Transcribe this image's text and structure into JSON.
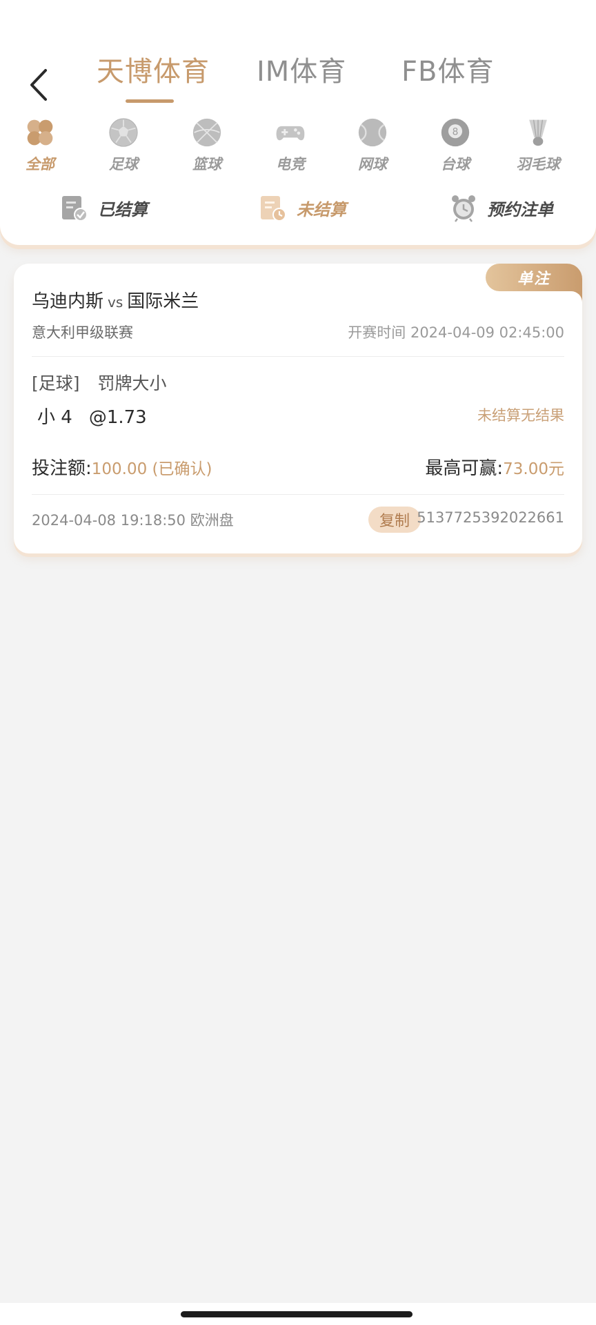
{
  "header": {
    "provider_tabs": [
      {
        "label": "天博体育"
      },
      {
        "label": "IM体育"
      },
      {
        "label": "FB体育"
      }
    ],
    "sports": [
      {
        "label": "全部",
        "icon": "clover-icon"
      },
      {
        "label": "足球",
        "icon": "soccer-ball-icon"
      },
      {
        "label": "篮球",
        "icon": "basketball-icon"
      },
      {
        "label": "电竞",
        "icon": "gamepad-icon"
      },
      {
        "label": "网球",
        "icon": "tennis-ball-icon"
      },
      {
        "label": "台球",
        "icon": "billiard-ball-icon"
      },
      {
        "label": "羽毛球",
        "icon": "shuttlecock-icon"
      }
    ],
    "status_tabs": [
      {
        "label": "已结算",
        "icon": "settled-doc-icon"
      },
      {
        "label": "未结算",
        "icon": "unsettled-doc-icon"
      },
      {
        "label": "预约注单",
        "icon": "alarm-clock-icon"
      }
    ]
  },
  "bet": {
    "badge": "单注",
    "home_team": "乌迪内斯",
    "vs": "vs",
    "away_team": "国际米兰",
    "league": "意大利甲级联赛",
    "start_time": "开赛时间 2024-04-09 02:45:00",
    "sport_tag": "[足球]",
    "market": "罚牌大小",
    "selection": "小 4",
    "odds": "@1.73",
    "result": "未结算无结果",
    "stake_label": "投注额:",
    "stake_value": "100.00 (已确认)",
    "win_label": "最高可赢:",
    "win_value": "73.00元",
    "bet_time": "2024-04-08 19:18:50 欧洲盘",
    "copy_label": "复制",
    "order_id": "5137725392022661"
  },
  "colors": {
    "accent": "#c79a6c",
    "background": "#f3f3f3",
    "card": "#ffffff"
  }
}
